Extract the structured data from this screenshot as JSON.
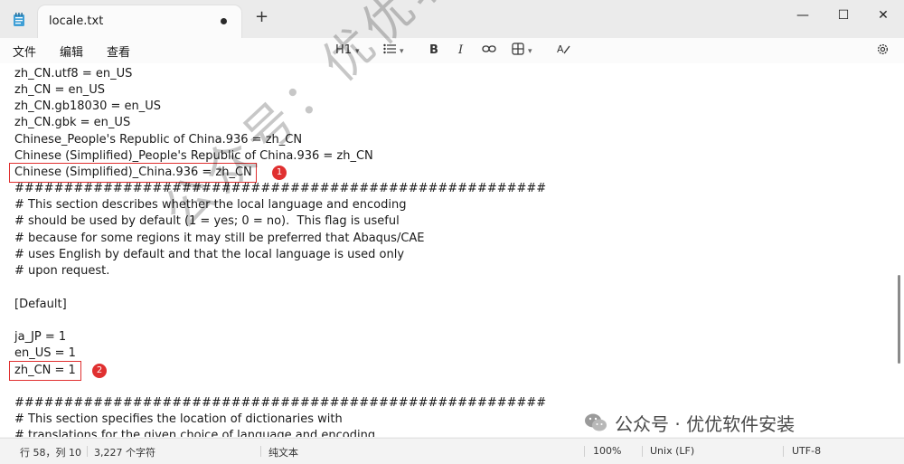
{
  "window": {
    "tab_title": "locale.txt",
    "new_tab": "+",
    "minimize": "—",
    "maximize": "☐",
    "close": "✕"
  },
  "menu": {
    "file": "文件",
    "edit": "编辑",
    "view": "查看"
  },
  "toolbar": {
    "heading": "H1",
    "bold": "B",
    "italic": "I"
  },
  "editor": {
    "lines": [
      "zh_CN.utf8 = en_US",
      "zh_CN = en_US",
      "zh_CN.gb18030 = en_US",
      "zh_CN.gbk = en_US",
      "Chinese_People's Republic of China.936 = zh_CN",
      "Chinese (Simplified)_People's Republic of China.936 = zh_CN",
      "Chinese (Simplified)_China.936 = zh_CN",
      "######################################################",
      "# This section describes whether the local language and encoding",
      "# should be used by default (1 = yes; 0 = no).  This flag is useful",
      "# because for some regions it may still be preferred that Abaqus/CAE",
      "# uses English by default and that the local language is used only",
      "# upon request.",
      "",
      "[Default]",
      "",
      "ja_JP = 1",
      "en_US = 1",
      "zh_CN = 1",
      "",
      "######################################################",
      "# This section specifies the location of dictionaries with",
      "# translations for the given choice of language and encoding"
    ],
    "marker1": "1",
    "marker2": "2"
  },
  "watermark": {
    "text": "公众号：优优软件安装",
    "brand": "公众号 · 优优软件安装"
  },
  "status": {
    "position": "行 58，列 10",
    "chars": "3,227 个字符",
    "format": "纯文本",
    "zoom": "100%",
    "eol": "Unix (LF)",
    "encoding": "UTF-8"
  },
  "colors": {
    "highlight": "#e03030",
    "background": "#ffffff"
  }
}
